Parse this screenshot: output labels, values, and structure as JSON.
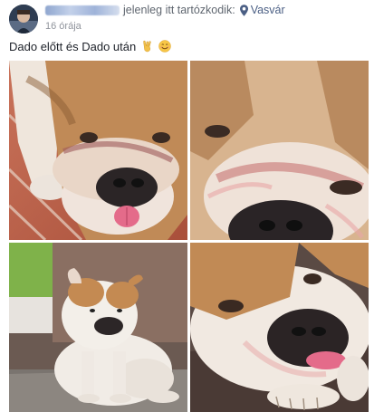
{
  "post": {
    "header_text": "jelenleg itt tartózkodik:",
    "location": "Vasvár",
    "time": "16 órája",
    "caption": "Dado előtt és Dado után",
    "caption_emojis": [
      "victory-hand",
      "smiling-face"
    ]
  },
  "photos": [
    {
      "alt": "bulldog-closeup-tongue"
    },
    {
      "alt": "bulldog-face-closeup"
    },
    {
      "alt": "bulldog-sitting"
    },
    {
      "alt": "bulldog-lying-tongue"
    }
  ],
  "colors": {
    "text": "#1d2129",
    "meta": "#90949c",
    "link": "#4b5f84"
  }
}
